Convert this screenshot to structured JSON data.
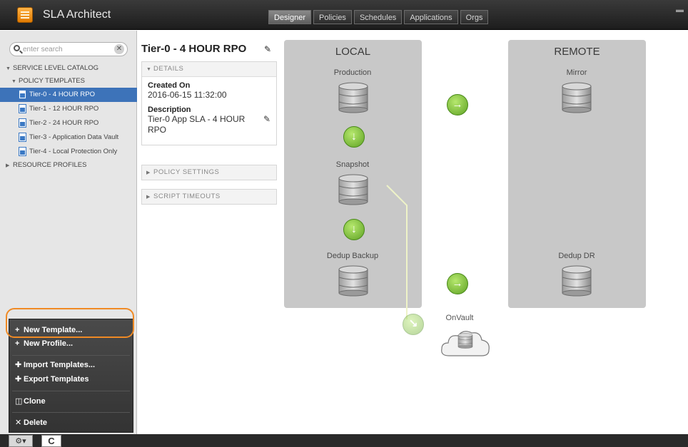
{
  "app": {
    "title": "SLA Architect"
  },
  "tabs": [
    "Designer",
    "Policies",
    "Schedules",
    "Applications",
    "Orgs"
  ],
  "search": {
    "placeholder": "enter search"
  },
  "tree": {
    "catalog": "SERVICE LEVEL CATALOG",
    "policy_templates": "POLICY TEMPLATES",
    "items": [
      "Tier-0 - 4 HOUR RPO",
      "Tier-1 - 12 HOUR RPO",
      "Tier-2 - 24 HOUR RPO",
      "Tier-3 - Application Data Vault",
      "Tier-4 - Local Protection Only"
    ],
    "resource_profiles": "RESOURCE PROFILES"
  },
  "menu": {
    "new_template": "New Template...",
    "new_profile": "New Profile...",
    "import_templates": "Import Templates...",
    "export_templates": "Export Templates",
    "clone": "Clone",
    "delete": "Delete"
  },
  "detail": {
    "title": "Tier-0 - 4 HOUR RPO",
    "details_header": "DETAILS",
    "created_label": "Created On",
    "created_value": "2016-06-15 11:32:00",
    "description_label": "Description",
    "description_value": "Tier-0 App SLA - 4 HOUR RPO",
    "policy_settings": "POLICY SETTINGS",
    "script_timeouts": "SCRIPT TIMEOUTS"
  },
  "diagram": {
    "local_title": "LOCAL",
    "remote_title": "REMOTE",
    "production": "Production",
    "snapshot": "Snapshot",
    "dedup_backup": "Dedup Backup",
    "mirror": "Mirror",
    "dedup_dr": "Dedup DR",
    "onvault": "OnVault"
  },
  "bottom": {
    "c_button": "C"
  },
  "colors": {
    "selected": "#3d73b9",
    "highlight_ring": "#f08a24",
    "arrow_green": "#5fa224"
  }
}
